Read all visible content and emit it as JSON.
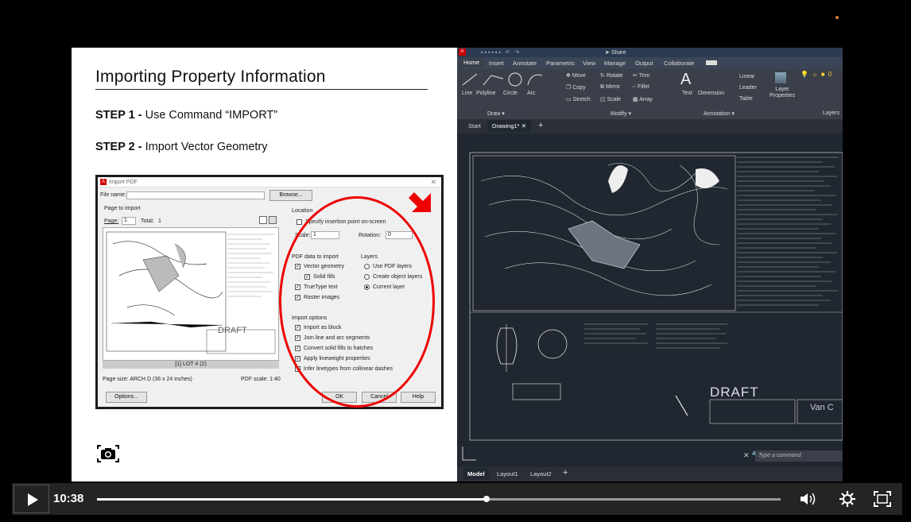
{
  "slide": {
    "title": "Importing Property Information",
    "step1_prefix": "STEP 1 -",
    "step1_text": " Use Command “IMPORT”",
    "step2_prefix": "STEP 2 -",
    "step2_text": " Import Vector Geometry"
  },
  "dialog": {
    "title": "Import PDF",
    "file_name_label": "File name:",
    "browse": "Browse...",
    "page_to_import": "Page to import",
    "page_label": "Page:",
    "page_value": "1",
    "total_label": "Total:",
    "total_value": "1",
    "preview_caption": "[1] LOT 4 (2)",
    "preview_draft": "DRAFT",
    "page_size": "Page size: ARCH D (36 x 24 inches)",
    "pdf_scale": "PDF scale: 1:40",
    "options": "Options...",
    "location": "Location",
    "specify_insertion": "Specify insertion point on-screen",
    "scale_label": "Scale:",
    "scale_value": "1",
    "rotation_label": "Rotation:",
    "rotation_value": "0",
    "pdf_data": "PDF data to import",
    "vector_geometry": "Vector geometry",
    "solid_fills": "Solid fills",
    "truetype_text": "TrueType text",
    "raster_images": "Raster images",
    "layers": "Layers",
    "use_pdf_layers": "Use PDF layers",
    "create_object_layers": "Create object layers",
    "current_layer": "Current layer",
    "import_options": "Import options",
    "import_as_block": "Import as block",
    "join_line": "Join line and arc segments",
    "convert_solid": "Convert solid fills to hatches",
    "apply_lineweight": "Apply lineweight properties",
    "infer_linetypes": "Infer linetypes from collinear dashes",
    "ok": "OK",
    "cancel": "Cancel",
    "help": "Help"
  },
  "autocad": {
    "share": "Share",
    "tabs": [
      "Home",
      "Insert",
      "Annotate",
      "Parametric",
      "View",
      "Manage",
      "Output",
      "Collaborate"
    ],
    "draw_tools": [
      "Line",
      "Polyline",
      "Circle",
      "Arc"
    ],
    "modify_tools": [
      "Move",
      "Rotate",
      "Trim",
      "Copy",
      "Mirror",
      "Fillet",
      "Stretch",
      "Scale",
      "Array"
    ],
    "annotation_tools": [
      "Text",
      "Dimension",
      "Linear",
      "Leader",
      "Table"
    ],
    "layer_properties": "Layer Properties",
    "panel_draw": "Draw ▾",
    "panel_modify": "Modify ▾",
    "panel_annotation": "Annotation ▾",
    "panel_layers": "Layers",
    "doc_start": "Start",
    "doc_drawing": "Drawing1*",
    "draft_label": "DRAFT",
    "company": "Van C",
    "command_placeholder": "Type a command",
    "layout_tabs": [
      "Model",
      "Layout1",
      "Layout2"
    ]
  },
  "player": {
    "time": "10:38",
    "progress": 0.57
  }
}
